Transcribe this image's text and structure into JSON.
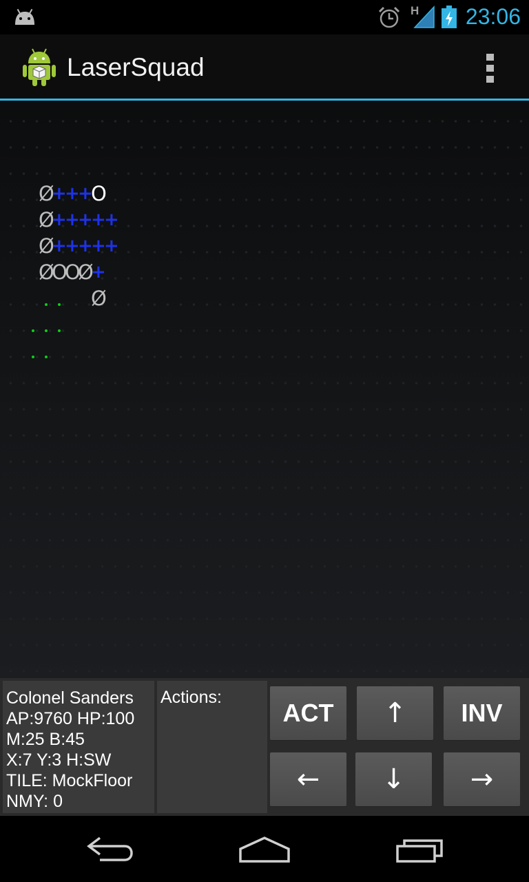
{
  "status_bar": {
    "time": "23:06",
    "network_type": "H",
    "icons": [
      "android-notification-icon",
      "alarm-icon",
      "signal-icon",
      "battery-charging-icon"
    ]
  },
  "action_bar": {
    "app_title": "LaserSquad",
    "app_icon": "android-robot-icon",
    "overflow_icon": "overflow-menu-icon"
  },
  "map": {
    "rows": [
      [
        {
          "ch": "Ø",
          "color": "#bdbdbd"
        },
        {
          "ch": "+",
          "color": "#1e32e8"
        },
        {
          "ch": "+",
          "color": "#1e32e8"
        },
        {
          "ch": "+",
          "color": "#1e32e8"
        },
        {
          "ch": "O",
          "color": "#ffffff"
        }
      ],
      [
        {
          "ch": "Ø",
          "color": "#bdbdbd"
        },
        {
          "ch": "+",
          "color": "#1e32e8"
        },
        {
          "ch": "+",
          "color": "#1e32e8"
        },
        {
          "ch": "+",
          "color": "#1e32e8"
        },
        {
          "ch": "+",
          "color": "#1e32e8"
        },
        {
          "ch": "+",
          "color": "#1e32e8"
        }
      ],
      [
        {
          "ch": "Ø",
          "color": "#bdbdbd"
        },
        {
          "ch": "+",
          "color": "#1e32e8"
        },
        {
          "ch": "+",
          "color": "#1e32e8"
        },
        {
          "ch": "+",
          "color": "#1e32e8"
        },
        {
          "ch": "+",
          "color": "#1e32e8"
        },
        {
          "ch": "+",
          "color": "#1e32e8"
        }
      ],
      [
        {
          "ch": "Ø",
          "color": "#bdbdbd"
        },
        {
          "ch": "O",
          "color": "#bdbdbd"
        },
        {
          "ch": "O",
          "color": "#bdbdbd"
        },
        {
          "ch": "Ø",
          "color": "#bdbdbd"
        },
        {
          "ch": "+",
          "color": "#1e32e8"
        }
      ],
      [
        {
          "ch": "Ø",
          "color": "#bdbdbd"
        }
      ]
    ],
    "floor_color": "#1f2327",
    "visible_floor_color": "#0dcf18"
  },
  "hud": {
    "unit": {
      "name": "Colonel Sanders",
      "stats_line1": "AP:9760 HP:100",
      "stats_line2": "M:25 B:45",
      "position": "X:7 Y:3 H:SW",
      "tile": "TILE: MockFloor",
      "enemies": "NMY: 0"
    },
    "actions_label": "Actions:",
    "buttons": {
      "act": "ACT",
      "up": "↑",
      "inv": "INV",
      "left": "←",
      "down": "↓",
      "right": "→"
    }
  },
  "nav_bar": {
    "icons": [
      "back-icon",
      "home-icon",
      "recent-apps-icon"
    ]
  }
}
